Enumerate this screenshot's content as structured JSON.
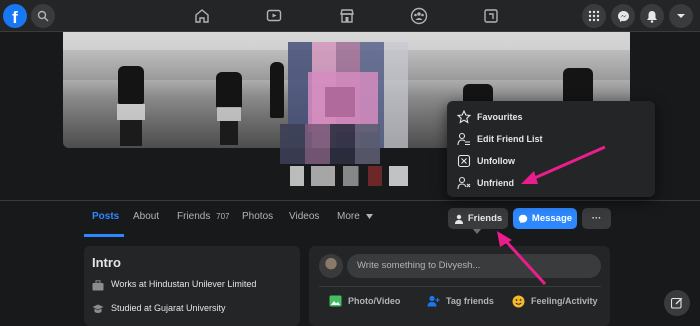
{
  "topbar": {
    "logo": "f",
    "icons": [
      "search-icon",
      "home-icon",
      "watch-icon",
      "marketplace-icon",
      "groups-icon",
      "gaming-icon",
      "menu-grid-icon",
      "messenger-icon",
      "notifications-icon",
      "account-caret-icon"
    ]
  },
  "profile": {
    "name_redacted": true
  },
  "tabs": {
    "posts": "Posts",
    "about": "About",
    "friends": "Friends",
    "friends_count": "707",
    "photos": "Photos",
    "videos": "Videos",
    "more": "More"
  },
  "actions": {
    "friends_button": "Friends",
    "message_button": "Message",
    "more_button": "···"
  },
  "friend_menu": {
    "items": [
      {
        "label": "Favourites",
        "icon": "star-icon"
      },
      {
        "label": "Edit Friend List",
        "icon": "edit-list-icon"
      },
      {
        "label": "Unfollow",
        "icon": "unfollow-icon"
      },
      {
        "label": "Unfriend",
        "icon": "unfriend-icon"
      }
    ]
  },
  "intro": {
    "title": "Intro",
    "items": [
      {
        "text": "Works at Hindustan Unilever Limited",
        "icon": "briefcase-icon"
      },
      {
        "text": "Studied at Gujarat University",
        "icon": "graduation-cap-icon"
      }
    ]
  },
  "composer": {
    "placeholder": "Write something to Divyesh...",
    "photo_video": "Photo/Video",
    "tag_friends": "Tag friends",
    "feeling_activity": "Feeling/Activity"
  },
  "colors": {
    "accent_blue": "#2d88ff",
    "facebook_blue": "#1877f2",
    "annotation_arrow": "#e91e8c",
    "background": "#18191a",
    "surface": "#242526"
  }
}
